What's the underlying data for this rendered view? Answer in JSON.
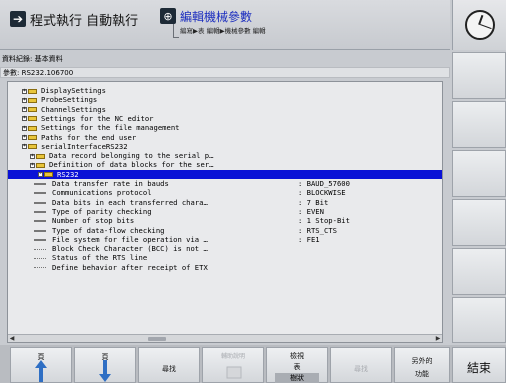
{
  "header": {
    "mode_title": "程式執行 自動執行",
    "edit_title": "編輯機械參數",
    "edit_breadcrumb": "編寫▶表 編輯▶機械參數 編輯"
  },
  "info": {
    "record": "資料紀錄: 基本資料",
    "parameter": "參數: RS232.106700"
  },
  "tree": [
    {
      "label": "DisplaySettings",
      "type": "folder",
      "level": 0
    },
    {
      "label": "ProbeSettings",
      "type": "folder",
      "level": 0
    },
    {
      "label": "ChannelSettings",
      "type": "folder",
      "level": 0
    },
    {
      "label": "Settings for the NC editor",
      "type": "folder",
      "level": 0
    },
    {
      "label": "Settings for the file management",
      "type": "folder",
      "level": 0
    },
    {
      "label": "Paths for the end user",
      "type": "folder",
      "level": 0
    },
    {
      "label": "serialInterfaceRS232",
      "type": "folder",
      "level": 0
    },
    {
      "label": "Data record belonging to the serial p…",
      "type": "folder",
      "level": 1
    },
    {
      "label": "Definition of data blocks for the ser…",
      "type": "folder",
      "level": 1
    },
    {
      "label": "RS232",
      "type": "folder",
      "level": 2,
      "selected": true
    },
    {
      "label": "Data transfer rate in bauds",
      "type": "param",
      "value": ": BAUD_57600"
    },
    {
      "label": "Communications protocol",
      "type": "param",
      "value": ": BLOCKWISE"
    },
    {
      "label": "Data bits in each transferred chara…",
      "type": "param",
      "value": ": 7 Bit"
    },
    {
      "label": "Type of parity checking",
      "type": "param",
      "value": ": EVEN"
    },
    {
      "label": "Number of stop bits",
      "type": "param",
      "value": ": 1 Stop-Bit"
    },
    {
      "label": "Type of data-flow checking",
      "type": "param",
      "value": ": RTS_CTS"
    },
    {
      "label": "File system for file operation via …",
      "type": "param",
      "value": ": FE1"
    },
    {
      "label": "Block Check Character (BCC) is not …",
      "type": "optional"
    },
    {
      "label": "Status of the RTS line",
      "type": "optional"
    },
    {
      "label": "Define behavior after receipt of ETX",
      "type": "optional"
    }
  ],
  "softkeys": {
    "page_up": "頁",
    "page_down": "頁",
    "find": "尋找",
    "help": "輔助說明",
    "view_top": "檢視",
    "view_table": "表",
    "view_tree": "樹狀",
    "blank": "尋找",
    "extra_top": "另外的",
    "extra_bottom": "功能",
    "end": "結束"
  }
}
